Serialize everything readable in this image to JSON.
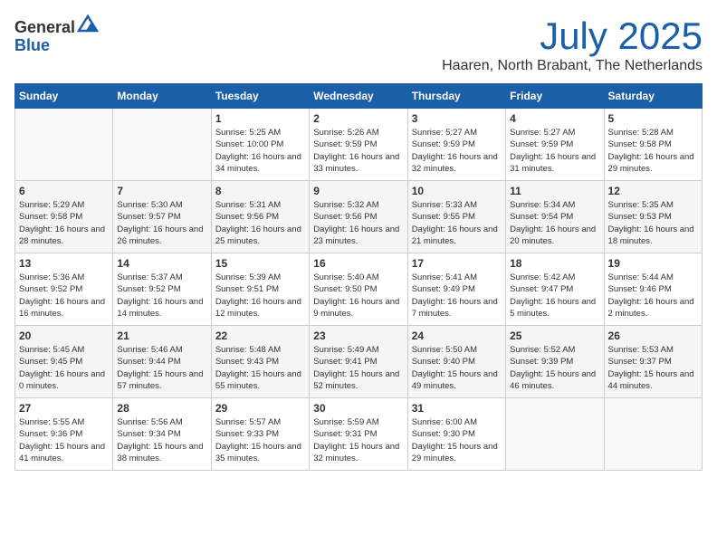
{
  "logo": {
    "line1": "General",
    "line2": "Blue"
  },
  "title": "July 2025",
  "location": "Haaren, North Brabant, The Netherlands",
  "weekdays": [
    "Sunday",
    "Monday",
    "Tuesday",
    "Wednesday",
    "Thursday",
    "Friday",
    "Saturday"
  ],
  "weeks": [
    [
      {
        "day": "",
        "detail": ""
      },
      {
        "day": "",
        "detail": ""
      },
      {
        "day": "1",
        "detail": "Sunrise: 5:25 AM\nSunset: 10:00 PM\nDaylight: 16 hours and 34 minutes."
      },
      {
        "day": "2",
        "detail": "Sunrise: 5:26 AM\nSunset: 9:59 PM\nDaylight: 16 hours and 33 minutes."
      },
      {
        "day": "3",
        "detail": "Sunrise: 5:27 AM\nSunset: 9:59 PM\nDaylight: 16 hours and 32 minutes."
      },
      {
        "day": "4",
        "detail": "Sunrise: 5:27 AM\nSunset: 9:59 PM\nDaylight: 16 hours and 31 minutes."
      },
      {
        "day": "5",
        "detail": "Sunrise: 5:28 AM\nSunset: 9:58 PM\nDaylight: 16 hours and 29 minutes."
      }
    ],
    [
      {
        "day": "6",
        "detail": "Sunrise: 5:29 AM\nSunset: 9:58 PM\nDaylight: 16 hours and 28 minutes."
      },
      {
        "day": "7",
        "detail": "Sunrise: 5:30 AM\nSunset: 9:57 PM\nDaylight: 16 hours and 26 minutes."
      },
      {
        "day": "8",
        "detail": "Sunrise: 5:31 AM\nSunset: 9:56 PM\nDaylight: 16 hours and 25 minutes."
      },
      {
        "day": "9",
        "detail": "Sunrise: 5:32 AM\nSunset: 9:56 PM\nDaylight: 16 hours and 23 minutes."
      },
      {
        "day": "10",
        "detail": "Sunrise: 5:33 AM\nSunset: 9:55 PM\nDaylight: 16 hours and 21 minutes."
      },
      {
        "day": "11",
        "detail": "Sunrise: 5:34 AM\nSunset: 9:54 PM\nDaylight: 16 hours and 20 minutes."
      },
      {
        "day": "12",
        "detail": "Sunrise: 5:35 AM\nSunset: 9:53 PM\nDaylight: 16 hours and 18 minutes."
      }
    ],
    [
      {
        "day": "13",
        "detail": "Sunrise: 5:36 AM\nSunset: 9:52 PM\nDaylight: 16 hours and 16 minutes."
      },
      {
        "day": "14",
        "detail": "Sunrise: 5:37 AM\nSunset: 9:52 PM\nDaylight: 16 hours and 14 minutes."
      },
      {
        "day": "15",
        "detail": "Sunrise: 5:39 AM\nSunset: 9:51 PM\nDaylight: 16 hours and 12 minutes."
      },
      {
        "day": "16",
        "detail": "Sunrise: 5:40 AM\nSunset: 9:50 PM\nDaylight: 16 hours and 9 minutes."
      },
      {
        "day": "17",
        "detail": "Sunrise: 5:41 AM\nSunset: 9:49 PM\nDaylight: 16 hours and 7 minutes."
      },
      {
        "day": "18",
        "detail": "Sunrise: 5:42 AM\nSunset: 9:47 PM\nDaylight: 16 hours and 5 minutes."
      },
      {
        "day": "19",
        "detail": "Sunrise: 5:44 AM\nSunset: 9:46 PM\nDaylight: 16 hours and 2 minutes."
      }
    ],
    [
      {
        "day": "20",
        "detail": "Sunrise: 5:45 AM\nSunset: 9:45 PM\nDaylight: 16 hours and 0 minutes."
      },
      {
        "day": "21",
        "detail": "Sunrise: 5:46 AM\nSunset: 9:44 PM\nDaylight: 15 hours and 57 minutes."
      },
      {
        "day": "22",
        "detail": "Sunrise: 5:48 AM\nSunset: 9:43 PM\nDaylight: 15 hours and 55 minutes."
      },
      {
        "day": "23",
        "detail": "Sunrise: 5:49 AM\nSunset: 9:41 PM\nDaylight: 15 hours and 52 minutes."
      },
      {
        "day": "24",
        "detail": "Sunrise: 5:50 AM\nSunset: 9:40 PM\nDaylight: 15 hours and 49 minutes."
      },
      {
        "day": "25",
        "detail": "Sunrise: 5:52 AM\nSunset: 9:39 PM\nDaylight: 15 hours and 46 minutes."
      },
      {
        "day": "26",
        "detail": "Sunrise: 5:53 AM\nSunset: 9:37 PM\nDaylight: 15 hours and 44 minutes."
      }
    ],
    [
      {
        "day": "27",
        "detail": "Sunrise: 5:55 AM\nSunset: 9:36 PM\nDaylight: 15 hours and 41 minutes."
      },
      {
        "day": "28",
        "detail": "Sunrise: 5:56 AM\nSunset: 9:34 PM\nDaylight: 15 hours and 38 minutes."
      },
      {
        "day": "29",
        "detail": "Sunrise: 5:57 AM\nSunset: 9:33 PM\nDaylight: 15 hours and 35 minutes."
      },
      {
        "day": "30",
        "detail": "Sunrise: 5:59 AM\nSunset: 9:31 PM\nDaylight: 15 hours and 32 minutes."
      },
      {
        "day": "31",
        "detail": "Sunrise: 6:00 AM\nSunset: 9:30 PM\nDaylight: 15 hours and 29 minutes."
      },
      {
        "day": "",
        "detail": ""
      },
      {
        "day": "",
        "detail": ""
      }
    ]
  ]
}
